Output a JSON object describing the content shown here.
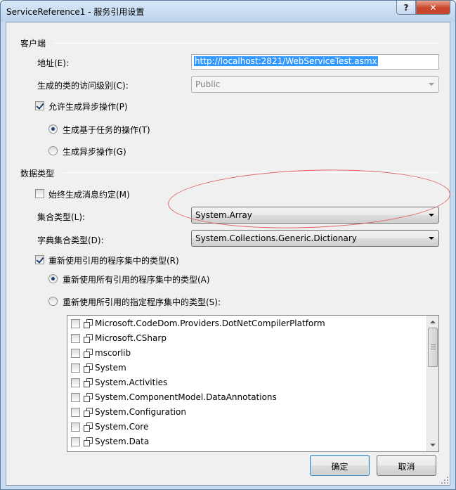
{
  "window": {
    "title": "ServiceReference1 - 服务引用设置",
    "help_label": "?",
    "close_label": "✕"
  },
  "client_section": {
    "group_label": "客户端",
    "address_label": "地址(E):",
    "address_value": "http://localhost:2821/WebServiceTest.asmx",
    "access_level_label": "生成的类的访问级别(C):",
    "access_level_value": "Public",
    "async_checkbox": {
      "label": "允许生成异步操作(P)",
      "checked": true
    },
    "radio_task": {
      "label": "生成基于任务的操作(T)",
      "selected": true
    },
    "radio_async": {
      "label": "生成异步操作(G)",
      "selected": false
    }
  },
  "data_type_section": {
    "group_label": "数据类型",
    "always_contract_checkbox": {
      "label": "始终生成消息约定(M)",
      "checked": false
    },
    "collection_type_label": "集合类型(L):",
    "collection_type_value": "System.Array",
    "dictionary_type_label": "字典集合类型(D):",
    "dictionary_type_value": "System.Collections.Generic.Dictionary",
    "reuse_types_checkbox": {
      "label": "重新使用引用的程序集中的类型(R)",
      "checked": true
    },
    "radio_reuse_all": {
      "label": "重新使用所有引用的程序集中的类型(A)",
      "selected": true
    },
    "radio_reuse_specified": {
      "label": "重新使用所引用的指定程序集中的类型(S):",
      "selected": false
    },
    "assemblies": [
      {
        "name": "Microsoft.CodeDom.Providers.DotNetCompilerPlatform",
        "checked": false
      },
      {
        "name": "Microsoft.CSharp",
        "checked": false
      },
      {
        "name": "mscorlib",
        "checked": false
      },
      {
        "name": "System",
        "checked": false
      },
      {
        "name": "System.Activities",
        "checked": false
      },
      {
        "name": "System.ComponentModel.DataAnnotations",
        "checked": false
      },
      {
        "name": "System.Configuration",
        "checked": false
      },
      {
        "name": "System.Core",
        "checked": false
      },
      {
        "name": "System.Data",
        "checked": false
      }
    ]
  },
  "buttons": {
    "ok_label": "确定",
    "cancel_label": "取消"
  },
  "colors": {
    "selection_highlight": "#3399ff",
    "annotation_ellipse": "#e06060",
    "close_button": "#c8462b"
  }
}
